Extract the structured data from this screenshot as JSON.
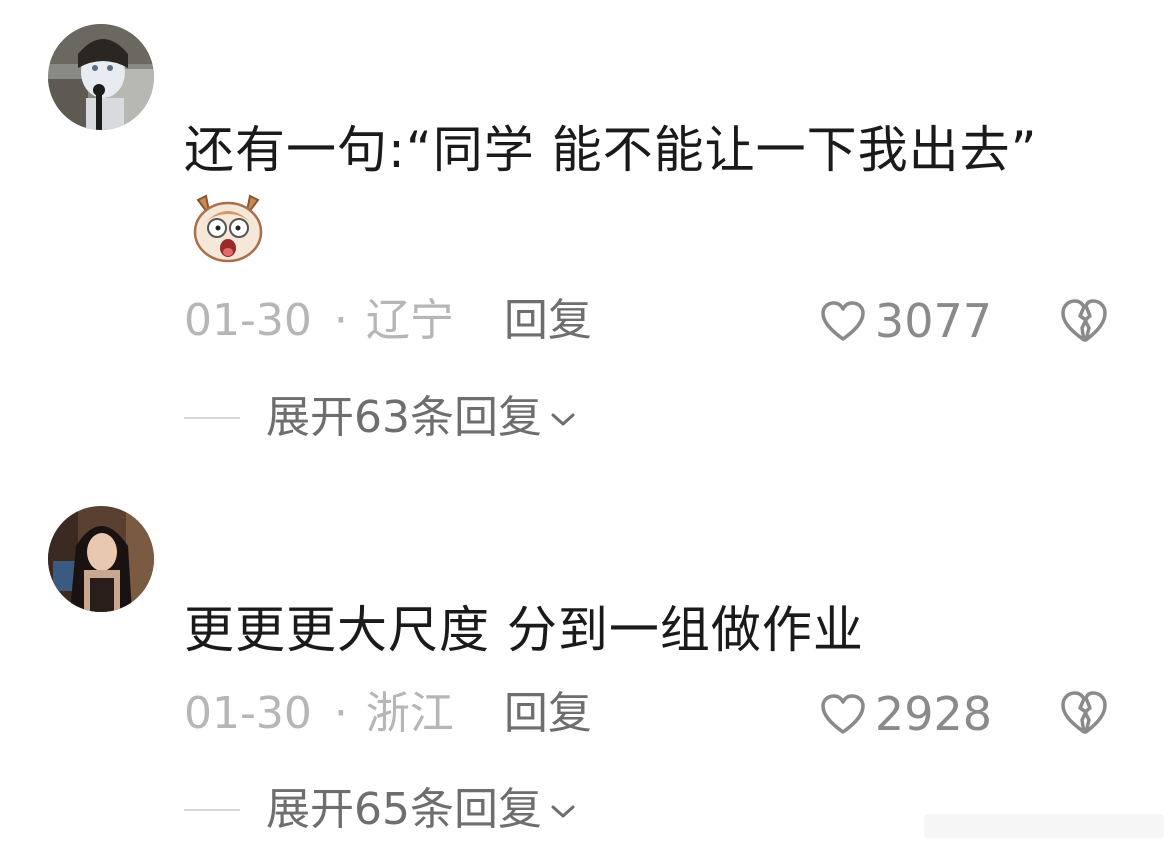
{
  "comments": [
    {
      "text": "还有一句:“同学 能不能让一下我出去”",
      "date": "01-30",
      "separator": "·",
      "location": "辽宁",
      "reply_label": "回复",
      "likes": "3077",
      "expand_label": "展开63条回复",
      "emoji_icon": "shocked-dog-emoji-icon"
    },
    {
      "text": "更更更大尺度 分到一组做作业",
      "date": "01-30",
      "separator": "·",
      "location": "浙江",
      "reply_label": "回复",
      "likes": "2928",
      "expand_label": "展开65条回复"
    }
  ],
  "icons": {
    "like": "heart-outline-icon",
    "dislike": "broken-heart-icon",
    "expand": "chevron-down-icon"
  },
  "colors": {
    "text_primary": "#1a1a1a",
    "text_meta": "#b6b6b6",
    "text_secondary": "#6e6e6e",
    "background": "#ffffff"
  }
}
